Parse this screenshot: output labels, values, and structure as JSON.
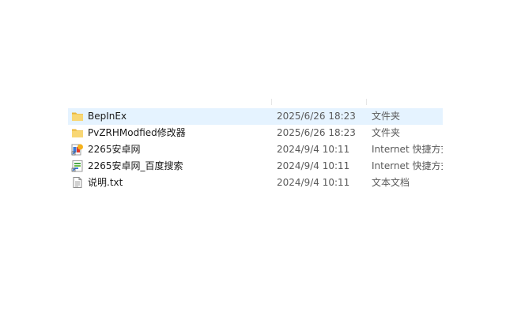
{
  "files": [
    {
      "name": "BepInEx",
      "date": "2025/6/26 18:23",
      "type": "文件夹",
      "icon": "folder-icon",
      "selected": true
    },
    {
      "name": "PvZRHModfied修改器",
      "date": "2025/6/26 18:23",
      "type": "文件夹",
      "icon": "folder-icon",
      "selected": false
    },
    {
      "name": "2265安卓网",
      "date": "2024/9/4 10:11",
      "type": "Internet 快捷方式",
      "icon": "internet-shortcut-icon",
      "selected": false
    },
    {
      "name": "2265安卓网_百度搜索",
      "date": "2024/9/4 10:11",
      "type": "Internet 快捷方式",
      "icon": "internet-shortcut-icon",
      "selected": false
    },
    {
      "name": "说明.txt",
      "date": "2024/9/4 10:11",
      "type": "文本文档",
      "icon": "text-document-icon",
      "selected": false
    }
  ],
  "colors": {
    "selection": "#e5f3ff",
    "folder": "#f8d775",
    "text_muted": "#5a5a5a"
  }
}
